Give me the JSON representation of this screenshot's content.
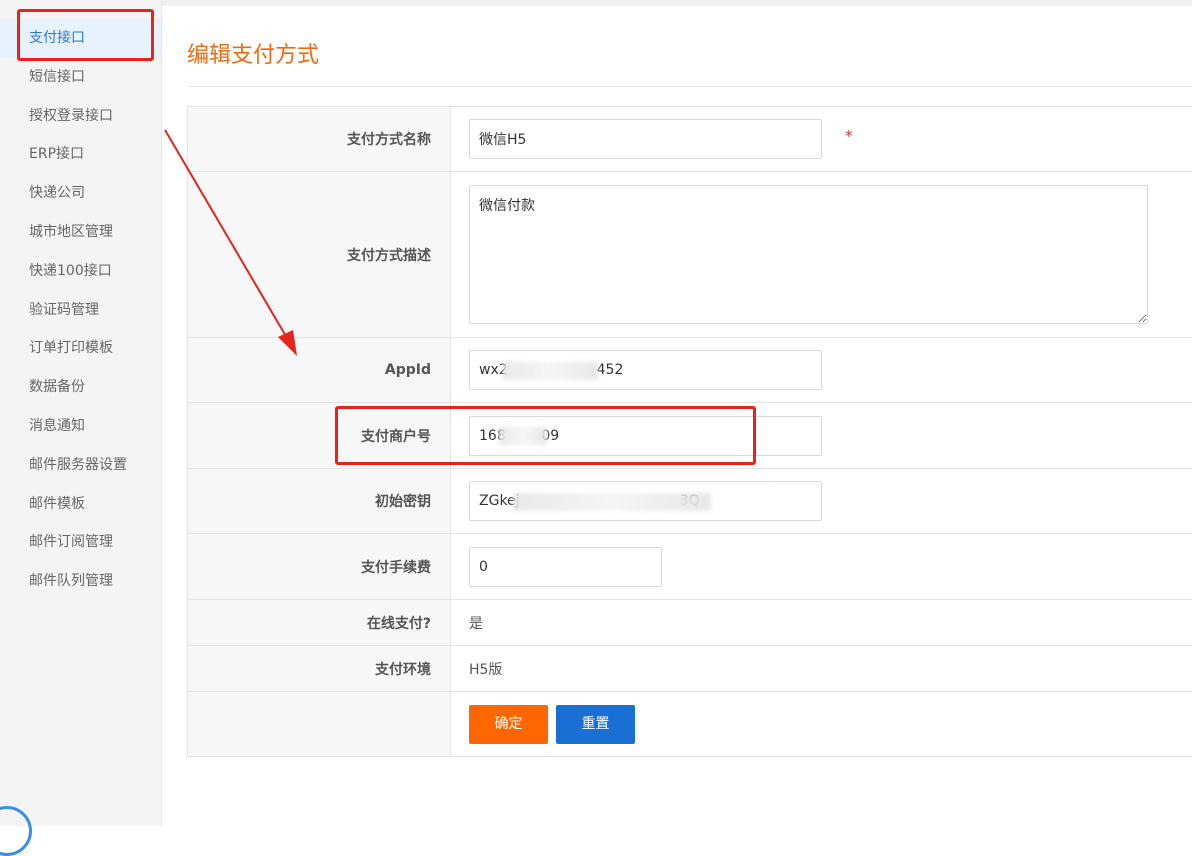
{
  "sidebar": {
    "items": [
      {
        "label": "支付接口",
        "active": true
      },
      {
        "label": "短信接口"
      },
      {
        "label": "授权登录接口"
      },
      {
        "label": "ERP接口"
      },
      {
        "label": "快递公司"
      },
      {
        "label": "城市地区管理"
      },
      {
        "label": "快递100接口"
      },
      {
        "label": "验证码管理"
      },
      {
        "label": "订单打印模板"
      },
      {
        "label": "数据备份"
      },
      {
        "label": "消息通知"
      },
      {
        "label": "邮件服务器设置"
      },
      {
        "label": "邮件模板"
      },
      {
        "label": "邮件订阅管理"
      },
      {
        "label": "邮件队列管理"
      }
    ]
  },
  "page": {
    "title": "编辑支付方式"
  },
  "form": {
    "name": {
      "label": "支付方式名称",
      "value": "微信H5",
      "required_mark": "*"
    },
    "description": {
      "label": "支付方式描述",
      "value": "微信付款"
    },
    "appid": {
      "label": "AppId",
      "value": "wx2                    452"
    },
    "merchant_id": {
      "label": "支付商户号",
      "value": "168        09"
    },
    "key": {
      "label": "初始密钥",
      "value": "ZGkej                                    3Q"
    },
    "fee": {
      "label": "支付手续费",
      "value": "0"
    },
    "online": {
      "label": "在线支付?",
      "value": "是"
    },
    "env": {
      "label": "支付环境",
      "value": "H5版"
    },
    "buttons": {
      "confirm": "确定",
      "reset": "重置"
    }
  },
  "colors": {
    "title": "#f26a10",
    "active_menu": "#2a7ad5",
    "confirm_button": "#ff6600",
    "reset_button": "#1a6fd4",
    "annotation": "#e5241b"
  }
}
